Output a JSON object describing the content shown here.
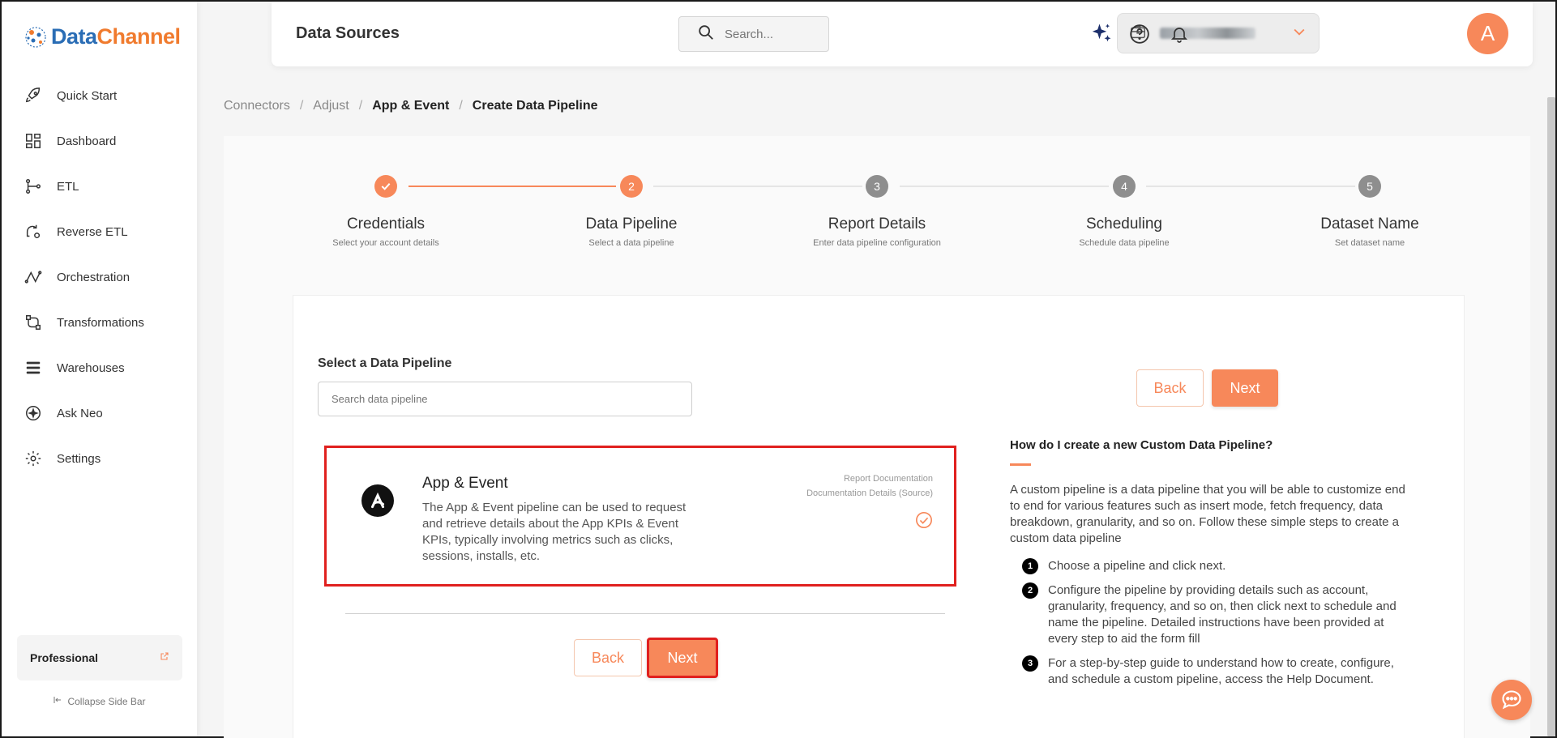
{
  "brand": {
    "name_part1": "Data",
    "name_part2": "Channel"
  },
  "sidebar": {
    "items": [
      {
        "label": "Quick Start",
        "icon": "rocket-icon"
      },
      {
        "label": "Dashboard",
        "icon": "dashboard-icon"
      },
      {
        "label": "ETL",
        "icon": "etl-icon"
      },
      {
        "label": "Reverse ETL",
        "icon": "reverse-etl-icon"
      },
      {
        "label": "Orchestration",
        "icon": "orchestration-icon"
      },
      {
        "label": "Transformations",
        "icon": "transformations-icon"
      },
      {
        "label": "Warehouses",
        "icon": "warehouses-icon"
      },
      {
        "label": "Ask Neo",
        "icon": "sparkle-icon"
      },
      {
        "label": "Settings",
        "icon": "gear-icon"
      }
    ],
    "plan_label": "Professional",
    "collapse_label": "Collapse Side Bar"
  },
  "header": {
    "title": "Data Sources",
    "search_placeholder": "Search...",
    "avatar_letter": "A"
  },
  "breadcrumb": [
    "Connectors",
    "Adjust",
    "App & Event",
    "Create Data Pipeline"
  ],
  "stepper": [
    {
      "num": "1",
      "title": "Credentials",
      "subtitle": "Select your account details",
      "state": "done"
    },
    {
      "num": "2",
      "title": "Data Pipeline",
      "subtitle": "Select a data pipeline",
      "state": "active"
    },
    {
      "num": "3",
      "title": "Report Details",
      "subtitle": "Enter data pipeline configuration",
      "state": "pending"
    },
    {
      "num": "4",
      "title": "Scheduling",
      "subtitle": "Schedule data pipeline",
      "state": "pending"
    },
    {
      "num": "5",
      "title": "Dataset Name",
      "subtitle": "Set dataset name",
      "state": "pending"
    }
  ],
  "content": {
    "select_title": "Select a Data Pipeline",
    "search_placeholder": "Search data pipeline",
    "back_label": "Back",
    "next_label": "Next",
    "pipeline": {
      "name": "App & Event",
      "description": "The App & Event pipeline can be used to request and retrieve details about the App KPIs & Event KPIs, typically involving metrics such as clicks, sessions, installs, etc.",
      "link1": "Report Documentation",
      "link2": "Documentation Details (Source)"
    },
    "help": {
      "title": "How do I create a new Custom Data Pipeline?",
      "intro": "A custom pipeline is a data pipeline that you will be able to customize end to end for various features such as insert mode, fetch frequency, data breakdown, granularity, and so on. Follow these simple steps to create a custom data pipeline",
      "steps": [
        {
          "num": "1",
          "text": "Choose a pipeline and click next."
        },
        {
          "num": "2",
          "text": "Configure the pipeline by providing details such as account, granularity, frequency, and so on, then click next to schedule and name the pipeline. Detailed instructions have been provided at every step to aid the form fill"
        },
        {
          "num": "3",
          "text": "For a step-by-step guide to understand how to create, configure, and schedule a custom pipeline, access the Help Document."
        }
      ]
    }
  },
  "colors": {
    "accent": "#f7885a",
    "highlight_border": "#e0201e",
    "brand_blue": "#2a6db5",
    "brand_orange": "#f07b2e"
  }
}
